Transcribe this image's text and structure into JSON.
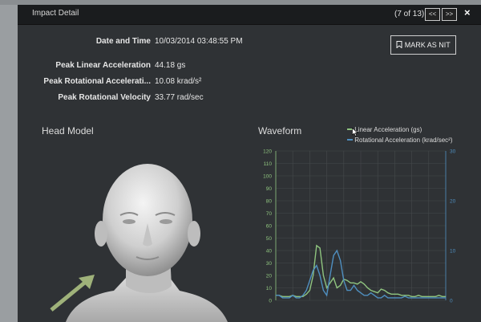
{
  "window": {
    "title": "Impact Detail",
    "counter": "(7 of 13)",
    "prev_label": "<<",
    "next_label": ">>",
    "close_label": "×"
  },
  "details": {
    "date_label": "Date and Time",
    "date_value": "10/03/2014 03:48:55 PM",
    "pla_label": "Peak Linear Acceleration",
    "pla_value": "44.18 gs",
    "pra_label": "Peak Rotational Accelerati...",
    "pra_value": "10.08 krad/s²",
    "prv_label": "Peak Rotational Velocity",
    "prv_value": "33.77 rad/sec"
  },
  "mark_button": {
    "label": "MARK AS NIT",
    "icon": "bookmark-icon"
  },
  "head_model": {
    "title": "Head Model"
  },
  "waveform": {
    "title": "Waveform",
    "legend_linear": "Linear Acceleration (gs)",
    "legend_rotational": "Rotational Acceleration (krad/sec²)",
    "colors": {
      "linear": "#8fc47f",
      "rotational": "#4f8fc0"
    }
  },
  "chart_data": {
    "type": "line",
    "left_axis": {
      "ticks": [
        "0",
        "10",
        "20",
        "30",
        "40",
        "50",
        "60",
        "70",
        "80",
        "90",
        "100",
        "110",
        "120"
      ],
      "ylim": [
        0,
        120
      ]
    },
    "right_axis": {
      "ticks": [
        "0",
        "10",
        "20",
        "30"
      ],
      "ylim": [
        0,
        30
      ]
    },
    "series": [
      {
        "name": "Linear Acceleration (gs)",
        "axis": "left",
        "x": [
          0,
          2,
          4,
          6,
          8,
          10,
          12,
          14,
          16,
          18,
          20,
          22,
          24,
          26,
          28,
          30,
          32,
          34,
          36,
          38,
          40,
          42,
          44,
          46,
          48,
          50,
          52,
          54,
          56,
          58,
          60,
          62,
          64,
          66,
          68,
          70,
          72,
          74,
          76,
          78,
          80,
          82,
          84,
          86,
          88,
          90,
          92,
          94,
          96,
          98,
          100
        ],
        "y": [
          4,
          4,
          3,
          3,
          3,
          4,
          3,
          3,
          3,
          5,
          8,
          20,
          44,
          42,
          20,
          10,
          14,
          18,
          10,
          12,
          17,
          16,
          14,
          14,
          13,
          15,
          13,
          10,
          8,
          7,
          6,
          9,
          8,
          6,
          5,
          5,
          5,
          4,
          4,
          4,
          3,
          3,
          4,
          3,
          3,
          3,
          3,
          3,
          4,
          3,
          3
        ]
      },
      {
        "name": "Rotational Acceleration (krad/sec²)",
        "axis": "right",
        "x": [
          0,
          2,
          4,
          6,
          8,
          10,
          12,
          14,
          16,
          18,
          20,
          22,
          24,
          26,
          28,
          30,
          32,
          34,
          36,
          38,
          40,
          42,
          44,
          46,
          48,
          50,
          52,
          54,
          56,
          58,
          60,
          62,
          64,
          66,
          68,
          70,
          72,
          74,
          76,
          78,
          80,
          82,
          84,
          86,
          88,
          90,
          92,
          94,
          96,
          98,
          100
        ],
        "y": [
          1,
          1,
          0.5,
          0.5,
          0.5,
          1,
          0.5,
          0.5,
          1,
          2,
          4,
          6,
          7,
          5,
          2,
          1,
          5,
          9,
          10,
          8,
          4,
          2,
          2,
          3,
          2,
          1.5,
          1,
          1,
          1.5,
          1,
          0.5,
          0.5,
          1,
          0.5,
          0.5,
          0.5,
          0.5,
          0.5,
          0.8,
          0.5,
          0.5,
          0.5,
          0.5,
          0.5,
          0.5,
          0.5,
          0.5,
          0.5,
          0.5,
          0.5,
          0.5
        ]
      }
    ]
  }
}
